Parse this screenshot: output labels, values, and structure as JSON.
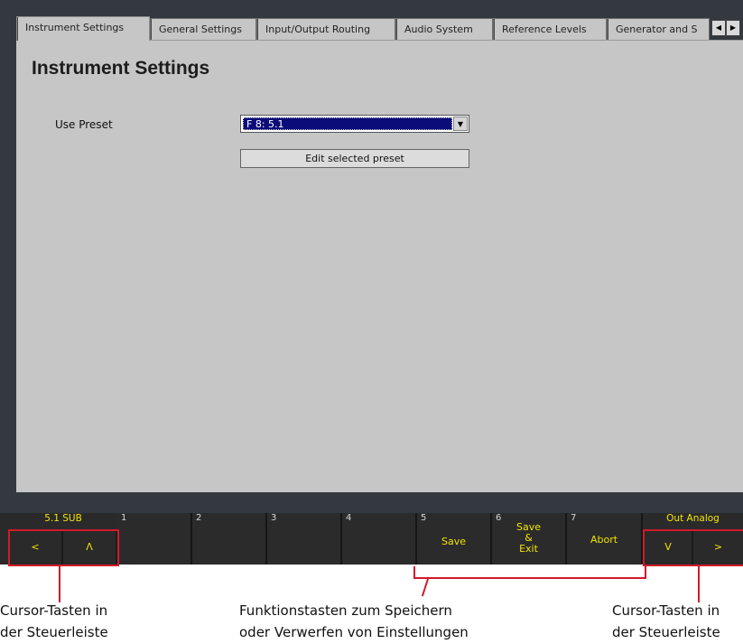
{
  "tabs": [
    {
      "label": "Instrument Settings",
      "active": true
    },
    {
      "label": "General Settings",
      "active": false
    },
    {
      "label": "Input/Output Routing",
      "active": false
    },
    {
      "label": "Audio System",
      "active": false
    },
    {
      "label": "Reference Levels",
      "active": false
    },
    {
      "label": "Generator and S",
      "active": false
    }
  ],
  "panel": {
    "title": "Instrument Settings",
    "use_preset_label": "Use Preset",
    "preset_value": "F 8: 5.1",
    "edit_button": "Edit selected preset"
  },
  "control_bar": {
    "left_status": "5.1 SUB",
    "right_status": "Out Analog",
    "nav_left": [
      "<",
      "Λ"
    ],
    "nav_right": [
      "V",
      ">"
    ],
    "keys": [
      {
        "num": "1",
        "label": ""
      },
      {
        "num": "2",
        "label": ""
      },
      {
        "num": "3",
        "label": ""
      },
      {
        "num": "4",
        "label": ""
      },
      {
        "num": "5",
        "label": "Save"
      },
      {
        "num": "6",
        "label": "Save\n&\nExit"
      },
      {
        "num": "7",
        "label": "Abort"
      }
    ]
  },
  "captions": {
    "left": [
      "Cursor-Tasten in",
      "der Steuerleiste"
    ],
    "center": [
      "Funktionstasten zum Speichern",
      "oder Verwerfen von Einstellungen"
    ],
    "right": [
      "Cursor-Tasten in",
      "der Steuerleiste"
    ]
  },
  "colors": {
    "frame": "#33393f",
    "panel": "#c6c6c6",
    "select_highlight": "#0b0b7a",
    "control_text": "#f2e400",
    "annotation": "#d11a2a"
  }
}
